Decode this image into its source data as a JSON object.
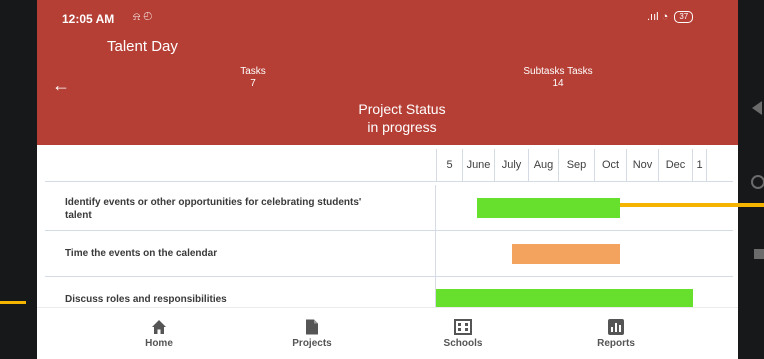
{
  "status_bar": {
    "time": "12:05 AM",
    "left_icons": "⍾ ◴",
    "signal_wifi": ".ııl ◔",
    "battery": "37"
  },
  "header": {
    "title": "Talent Day",
    "tasks_label": "Tasks",
    "tasks_count": "7",
    "subtasks_label": "Subtasks Tasks",
    "subtasks_count": "14",
    "status_title": "Project Status",
    "status_value": "in progress",
    "back_icon": "arrow-left",
    "color": "#b53f35"
  },
  "gantt": {
    "months": [
      "5",
      "June",
      "July",
      "Aug",
      "Sep",
      "Oct",
      "Nov",
      "Dec",
      "1"
    ],
    "tasks": [
      {
        "label": "Identify events or other opportunities for celebrating students' talent",
        "color": "#66e02c"
      },
      {
        "label": "Time the events on the calendar",
        "color": "#f3a35e"
      },
      {
        "label": "Discuss roles and responsibilities",
        "color": "#66e02c"
      }
    ]
  },
  "bottom_nav": [
    {
      "label": "Home",
      "icon": "home-icon"
    },
    {
      "label": "Projects",
      "icon": "document-icon"
    },
    {
      "label": "Schools",
      "icon": "building-icon"
    },
    {
      "label": "Reports",
      "icon": "chart-icon"
    }
  ]
}
